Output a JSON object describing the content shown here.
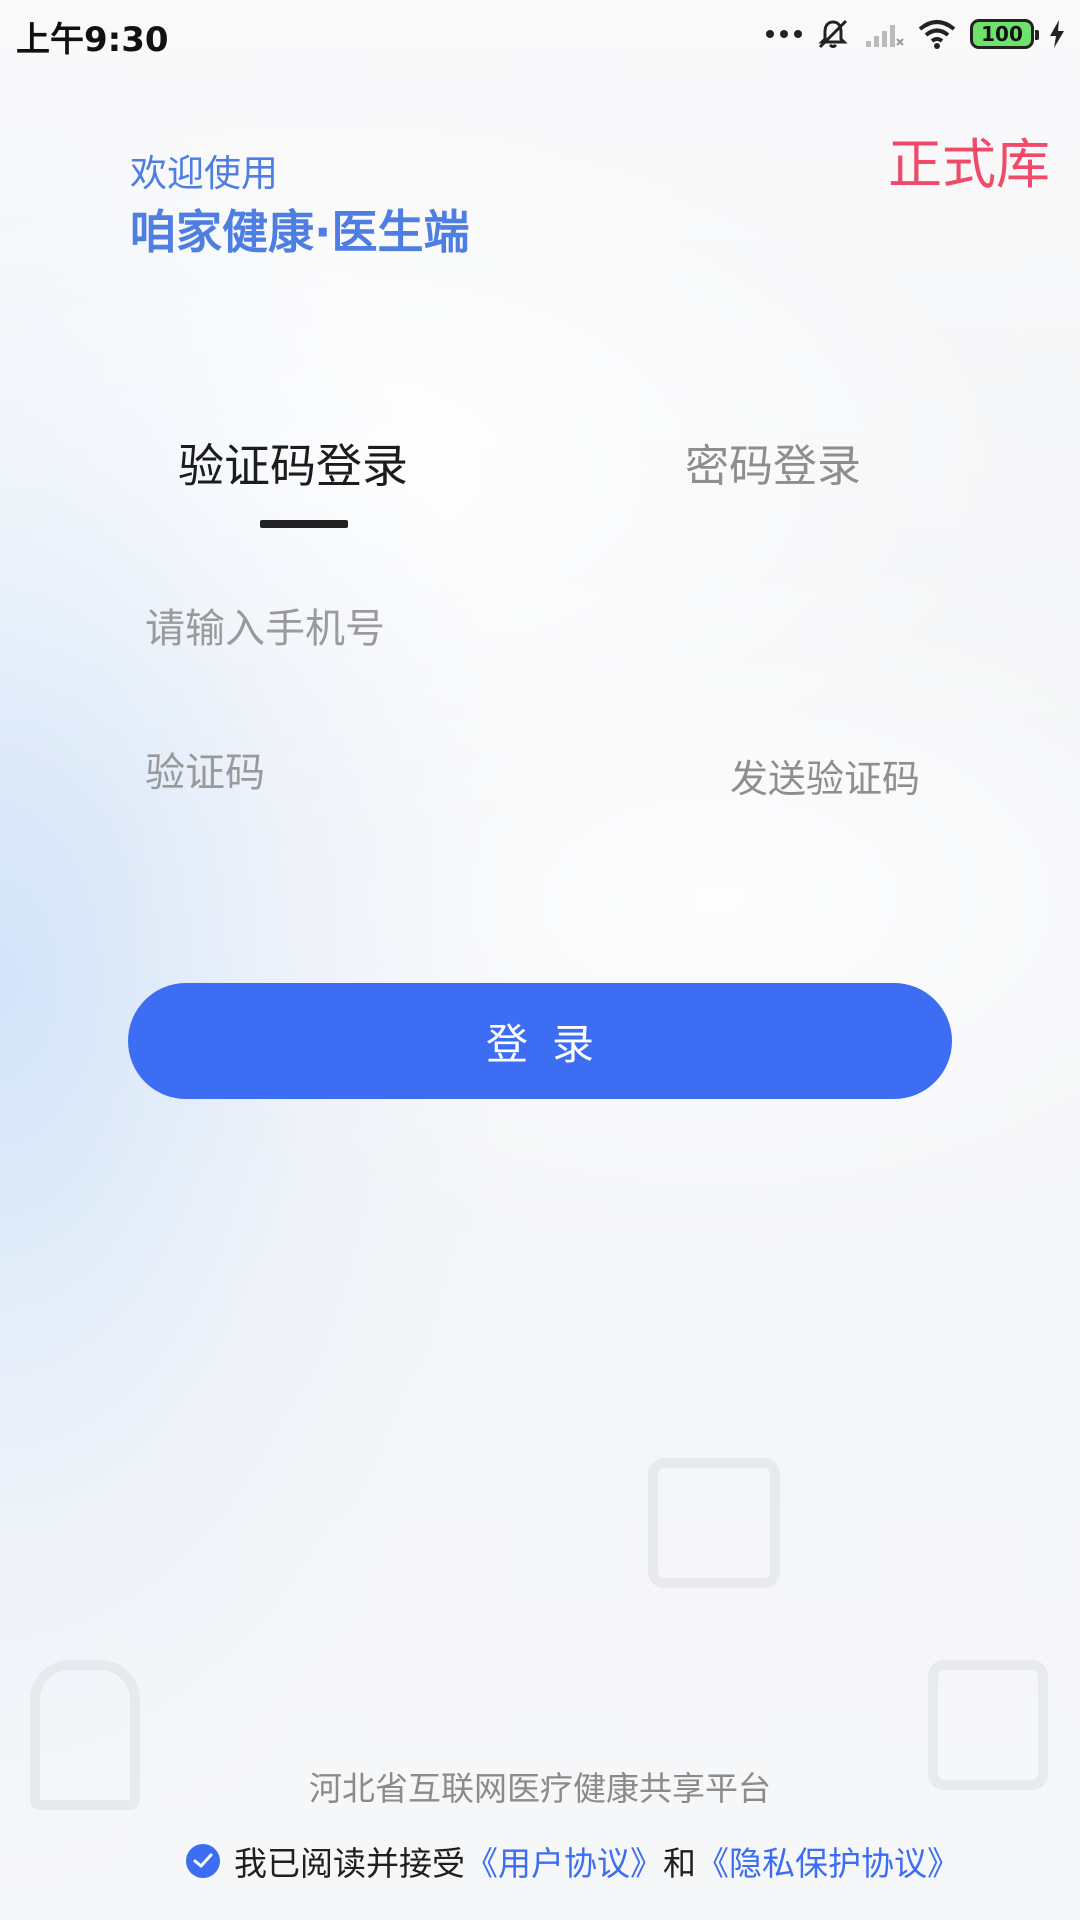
{
  "status_bar": {
    "time": "上午9:30",
    "battery": "100",
    "icons": [
      "more-dots-icon",
      "mute-icon",
      "signal-icon",
      "wifi-icon",
      "battery-icon",
      "charging-icon"
    ]
  },
  "header": {
    "welcome": "欢迎使用",
    "app_name": "咱家健康·医生端",
    "env_badge": "正式库"
  },
  "tabs": [
    {
      "label": "验证码登录",
      "active": true
    },
    {
      "label": "密码登录",
      "active": false
    }
  ],
  "form": {
    "phone_placeholder": "请输入手机号",
    "code_placeholder": "验证码",
    "send_code_label": "发送验证码",
    "login_label": "登录"
  },
  "footer": {
    "platform": "河北省互联网医疗健康共享平台",
    "agreement_prefix": "我已阅读并接受",
    "user_agreement": "《用户协议》",
    "and": "和",
    "privacy_agreement": "《隐私保护协议》",
    "agreement_checked": true
  },
  "colors": {
    "primary": "#3c6df2",
    "header_text": "#4f7ee3",
    "env_badge": "#ef4a6a"
  }
}
